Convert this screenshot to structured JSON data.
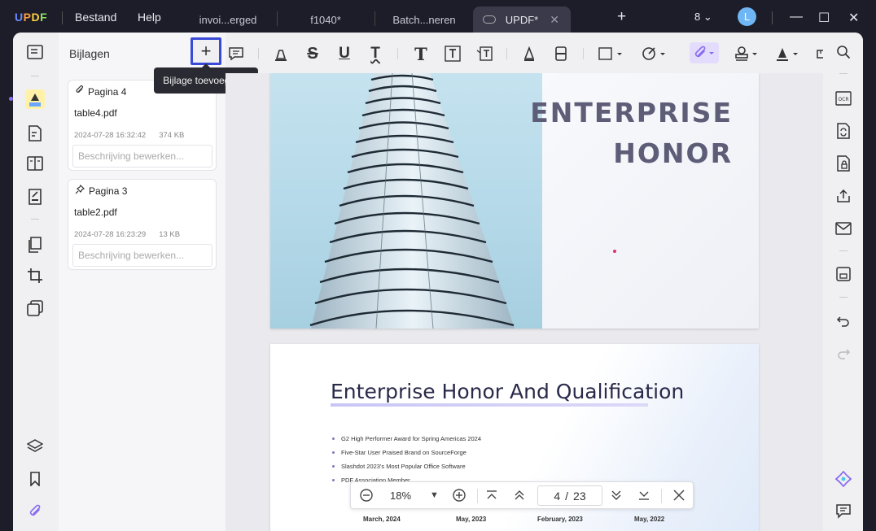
{
  "app": {
    "logo": "UPDF"
  },
  "menu": {
    "file": "Bestand",
    "help": "Help"
  },
  "tabs": [
    {
      "label": "invoi...erged"
    },
    {
      "label": "f1040*"
    },
    {
      "label": "Batch...neren"
    },
    {
      "label": "UPDF*",
      "active": true
    }
  ],
  "titlebar": {
    "new_tab": "+",
    "tab_count": "8",
    "avatar": "L"
  },
  "panel": {
    "title": "Bijlagen",
    "add_tooltip": "Bijlage toevoegen...",
    "attachments": [
      {
        "page": "Pagina 4",
        "file": "table4.pdf",
        "date": "2024-07-28 16:32:42",
        "size": "374 KB",
        "placeholder": "Beschrijving bewerken..."
      },
      {
        "page": "Pagina 3",
        "file": "table2.pdf",
        "date": "2024-07-28 16:23:29",
        "size": "13 KB",
        "placeholder": "Beschrijving bewerken..."
      }
    ]
  },
  "document": {
    "page1": {
      "line1": "ENTERPRISE",
      "line2": "HONOR"
    },
    "page2": {
      "title": "Enterprise Honor And Qualification",
      "bullets": [
        "G2 High Performer Award for Spring Americas 2024",
        "Five-Star User Praised Brand on SourceForge",
        "Slashdot 2023's Most Popular Office Software",
        "PDF Association Member"
      ],
      "dates": [
        "March, 2024",
        "May, 2023",
        "February, 2023",
        "May, 2022"
      ]
    }
  },
  "navbar": {
    "zoom": "18%",
    "current_page": "4",
    "separator": "/",
    "total_pages": "23"
  },
  "colors": {
    "accent": "#3a4ad8",
    "attachment_active": "#8a6cf0",
    "titlebar_bg": "#1d1d2a"
  }
}
